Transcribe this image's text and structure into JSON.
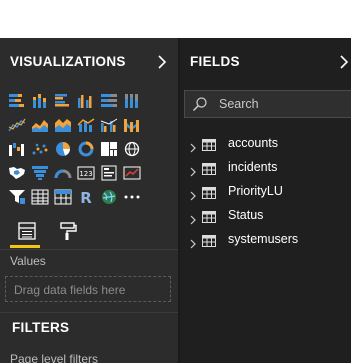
{
  "visualizations": {
    "title": "VISUALIZATIONS",
    "icons": [
      [
        "stacked-bar-chart-icon",
        "stacked-column-chart-icon",
        "clustered-bar-chart-icon",
        "clustered-column-chart-icon",
        "100-stacked-bar-chart-icon",
        "100-stacked-column-chart-icon"
      ],
      [
        "line-chart-icon",
        "area-chart-icon",
        "stacked-area-chart-icon",
        "line-and-stacked-column-chart-icon",
        "line-and-clustered-column-chart-icon",
        "ribbon-chart-icon"
      ],
      [
        "waterfall-chart-icon",
        "scatter-chart-icon",
        "pie-chart-icon",
        "donut-chart-icon",
        "treemap-icon",
        "map-icon"
      ],
      [
        "filled-map-icon",
        "funnel-icon",
        "gauge-icon",
        "card-icon",
        "multi-row-card-icon",
        "kpi-icon"
      ],
      [
        "slicer-icon",
        "table-icon",
        "matrix-icon",
        "r-visual-icon",
        "arcgis-map-icon",
        "more-visuals-icon"
      ]
    ],
    "tabs": [
      "fields-tab-icon",
      "format-paint-roller-icon"
    ],
    "values_label": "Values",
    "drop_placeholder": "Drag data fields here"
  },
  "filters": {
    "title": "FILTERS",
    "page_level": "Page level filters"
  },
  "fields": {
    "title": "FIELDS",
    "search_placeholder": "Search",
    "tables": [
      "accounts",
      "incidents",
      "PriorityLU",
      "Status",
      "systemusers"
    ]
  },
  "colors": {
    "viz_bg": "#2c2c2c",
    "fields_bg": "#1f1f1f",
    "accent_yellow": "#f2c811",
    "icon_blue": "#3b8fd9",
    "icon_orange": "#f2a33a"
  }
}
